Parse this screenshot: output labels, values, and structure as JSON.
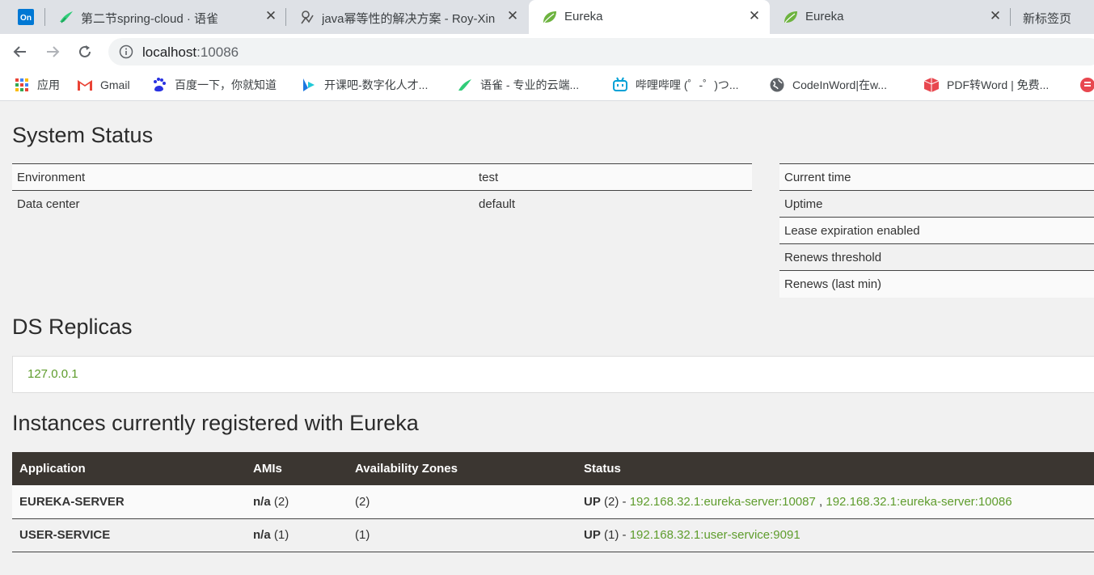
{
  "browser": {
    "tabs": [
      {
        "favicon": "yuque-icon",
        "title": "第二节spring-cloud · 语雀"
      },
      {
        "favicon": "cnblogs-icon",
        "title": "java幂等性的解决方案 - Roy-Xin"
      },
      {
        "favicon": "spring-leaf-icon",
        "title": "Eureka"
      },
      {
        "favicon": "spring-leaf-icon",
        "title": "Eureka"
      }
    ],
    "new_tab_label": "新标签页",
    "url_host": "localhost",
    "url_port": ":10086",
    "bookmarks": [
      {
        "icon": "apps-grid-icon",
        "label": "应用"
      },
      {
        "icon": "gmail-icon",
        "label": "Gmail"
      },
      {
        "icon": "baidu-paw-icon",
        "label": "百度一下，你就知道"
      },
      {
        "icon": "kaikeba-icon",
        "label": "开课吧-数字化人才..."
      },
      {
        "icon": "yuque-icon",
        "label": "语雀 - 专业的云端..."
      },
      {
        "icon": "bilibili-icon",
        "label": "哔哩哔哩 (゜-゜)つ..."
      },
      {
        "icon": "globe-icon",
        "label": "CodeInWord|在w..."
      },
      {
        "icon": "pdf-icon",
        "label": "PDF转Word | 免费..."
      }
    ]
  },
  "system_status": {
    "title": "System Status",
    "left": [
      {
        "key": "Environment",
        "value": "test"
      },
      {
        "key": "Data center",
        "value": "default"
      }
    ],
    "right": [
      {
        "key": "Current time"
      },
      {
        "key": "Uptime"
      },
      {
        "key": "Lease expiration enabled"
      },
      {
        "key": "Renews threshold"
      },
      {
        "key": "Renews (last min)"
      }
    ]
  },
  "ds_replicas": {
    "title": "DS Replicas",
    "items": [
      "127.0.0.1"
    ]
  },
  "instances": {
    "title": "Instances currently registered with Eureka",
    "headers": [
      "Application",
      "AMIs",
      "Availability Zones",
      "Status"
    ],
    "rows": [
      {
        "app": "EUREKA-SERVER",
        "ami_bold": "n/a",
        "ami_count": " (2)",
        "zones": "(2)",
        "status_bold": "UP",
        "status_count": " (2) - ",
        "links": [
          "192.168.32.1:eureka-server:10087",
          "192.168.32.1:eureka-server:10086"
        ],
        "link_sep": " , "
      },
      {
        "app": "USER-SERVICE",
        "ami_bold": "n/a",
        "ami_count": " (1)",
        "zones": "(1)",
        "status_bold": "UP",
        "status_count": " (1) - ",
        "links": [
          "192.168.32.1:user-service:9091"
        ]
      }
    ]
  },
  "colors": {
    "link_green": "#5e9c2c",
    "table_header": "#3b3631",
    "page_bg": "#f1f1f1"
  }
}
